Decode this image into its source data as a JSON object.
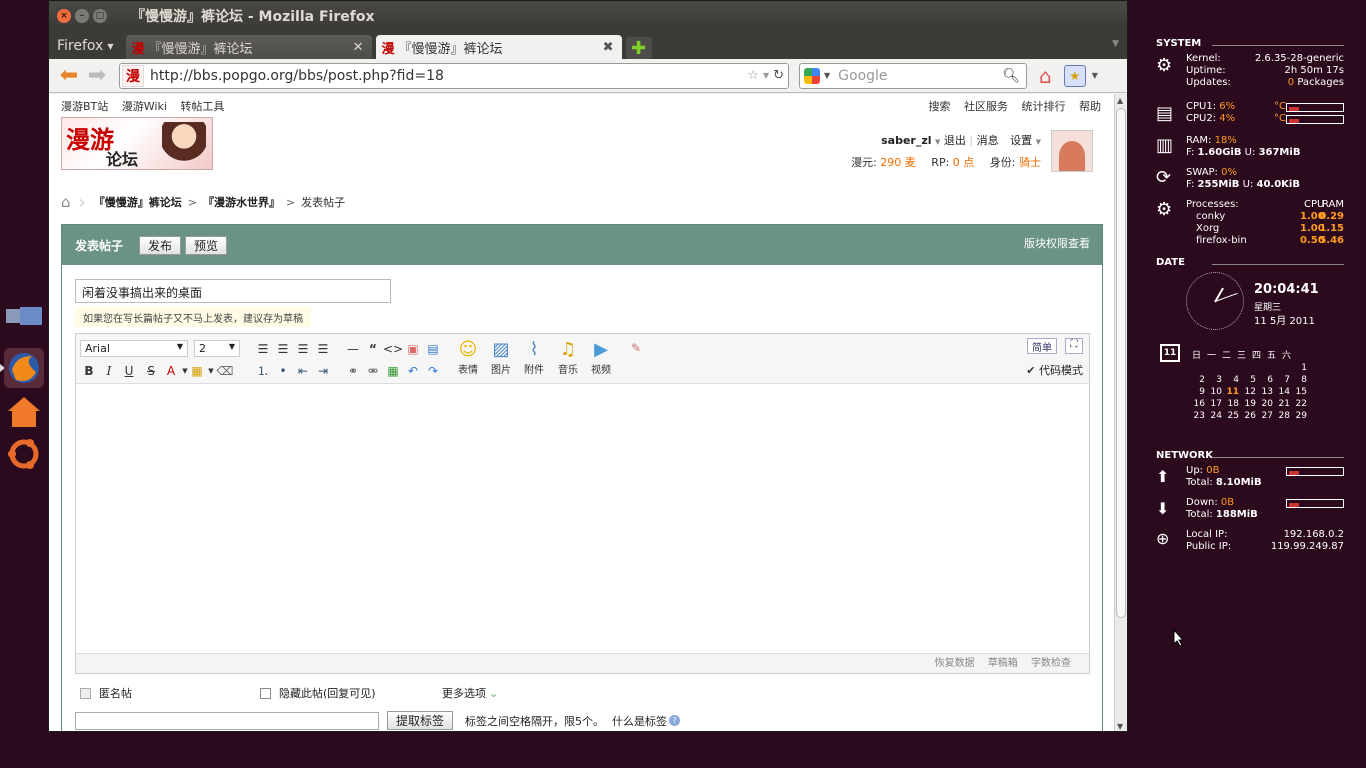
{
  "window": {
    "title": "『慢慢游』裤论坛 - Mozilla Firefox"
  },
  "tabs": {
    "menu_label": "Firefox",
    "items": [
      {
        "label": "『慢慢游』裤论坛",
        "active": false
      },
      {
        "label": "『慢慢游』裤论坛",
        "active": true
      }
    ],
    "favicon_char": "漫"
  },
  "navbar": {
    "url": "http://bbs.popgo.org/bbs/post.php?fid=18",
    "search_placeholder": "Google"
  },
  "site": {
    "top_left_links": [
      "漫游BT站",
      "漫游Wiki",
      "转帖工具"
    ],
    "top_right_links": [
      "搜索",
      "社区服务",
      "统计排行",
      "帮助"
    ],
    "logo_text_1": "漫游",
    "logo_text_2": "论坛",
    "user": {
      "name": "saber_zl",
      "logout": "退出",
      "messages": "消息",
      "settings": "设置",
      "coins_label": "漫元:",
      "coins_value": "290 麦",
      "rp_label": "RP:",
      "rp_value": "0 点",
      "rank_label": "身份:",
      "rank_value": "骑士"
    },
    "breadcrumb": {
      "forum": "『慢慢游』裤论坛",
      "board": "『漫游水世界』",
      "current": "发表帖子"
    }
  },
  "post": {
    "panel_title": "发表帖子",
    "publish_button": "发布",
    "preview_button": "预览",
    "permission_link": "版块权限查看",
    "subject_value": "闲着没事搞出来的桌面",
    "hint": "如果您在写长篇帖子又不马上发表，建议存为草稿",
    "font_name": "Arial",
    "font_size": "2",
    "big_tools": [
      "表情",
      "图片",
      "附件",
      "音乐",
      "视频"
    ],
    "simple_button": "简单",
    "code_mode": "代码模式",
    "footer_links": [
      "恢复数据",
      "草稿箱",
      "字数检查"
    ],
    "anonymous": "匿名帖",
    "hide_post": "隐藏此帖(回复可见)",
    "more_options": "更多选项",
    "extract_tags_button": "提取标签",
    "tag_hint": "标签之间空格隔开，限5个。",
    "what_is_tag": "什么是标签"
  },
  "conky": {
    "system_title": "SYSTEM",
    "kernel_label": "Kernel:",
    "kernel_value": "2.6.35-28-generic",
    "uptime_label": "Uptime:",
    "uptime_value": "2h 50m 17s",
    "updates_label": "Updates:",
    "updates_count": "0",
    "updates_unit": "Packages",
    "cpu1_label": "CPU1:",
    "cpu1_value": "6%",
    "cpu1": 0.06,
    "cpu2_label": "CPU2:",
    "cpu2_value": "4%",
    "cpu2": 0.04,
    "temp_unit": "°C",
    "ram_label": "RAM:",
    "ram_value": "18%",
    "ram_free_label": "F:",
    "ram_free": "1.60GiB",
    "ram_used_label": "U:",
    "ram_used": "367MiB",
    "swap_label": "SWAP:",
    "swap_value": "0%",
    "swap_free_label": "F:",
    "swap_free": "255MiB",
    "swap_used_label": "U:",
    "swap_used": "40.0KiB",
    "proc_label": "Processes:",
    "proc_cpu_header": "CPU",
    "proc_ram_header": "RAM",
    "processes": [
      {
        "name": "conky",
        "cpu": "1.00",
        "ram": "0.29"
      },
      {
        "name": "Xorg",
        "cpu": "1.00",
        "ram": "1.15"
      },
      {
        "name": "firefox-bin",
        "cpu": "0.50",
        "ram": "5.46"
      }
    ],
    "date_title": "DATE",
    "time": "20:04:41",
    "weekday": "星期三",
    "date_line": "11  5月 2011",
    "cal_icon_day": "11",
    "weekdays": "日一二三四五六",
    "calendar_rows": [
      [
        "",
        "",
        "",
        "",
        "",
        "",
        "1"
      ],
      [
        "2",
        "3",
        "4",
        "5",
        "6",
        "7",
        "8"
      ],
      [
        "9",
        "10",
        "11",
        "12",
        "13",
        "14",
        "15"
      ],
      [
        "16",
        "17",
        "18",
        "19",
        "20",
        "21",
        "22"
      ],
      [
        "23",
        "24",
        "25",
        "26",
        "27",
        "28",
        "29"
      ]
    ],
    "today": "11",
    "network_title": "NETWORK",
    "up_label": "Up:",
    "up_value": "0B",
    "up_total_label": "Total:",
    "up_total": "8.10MiB",
    "down_label": "Down:",
    "down_value": "0B",
    "down_total_label": "Total:",
    "down_total": "188MiB",
    "local_ip_label": "Local IP:",
    "local_ip": "192.168.0.2",
    "public_ip_label": "Public IP:",
    "public_ip": "119.99.249.87"
  }
}
